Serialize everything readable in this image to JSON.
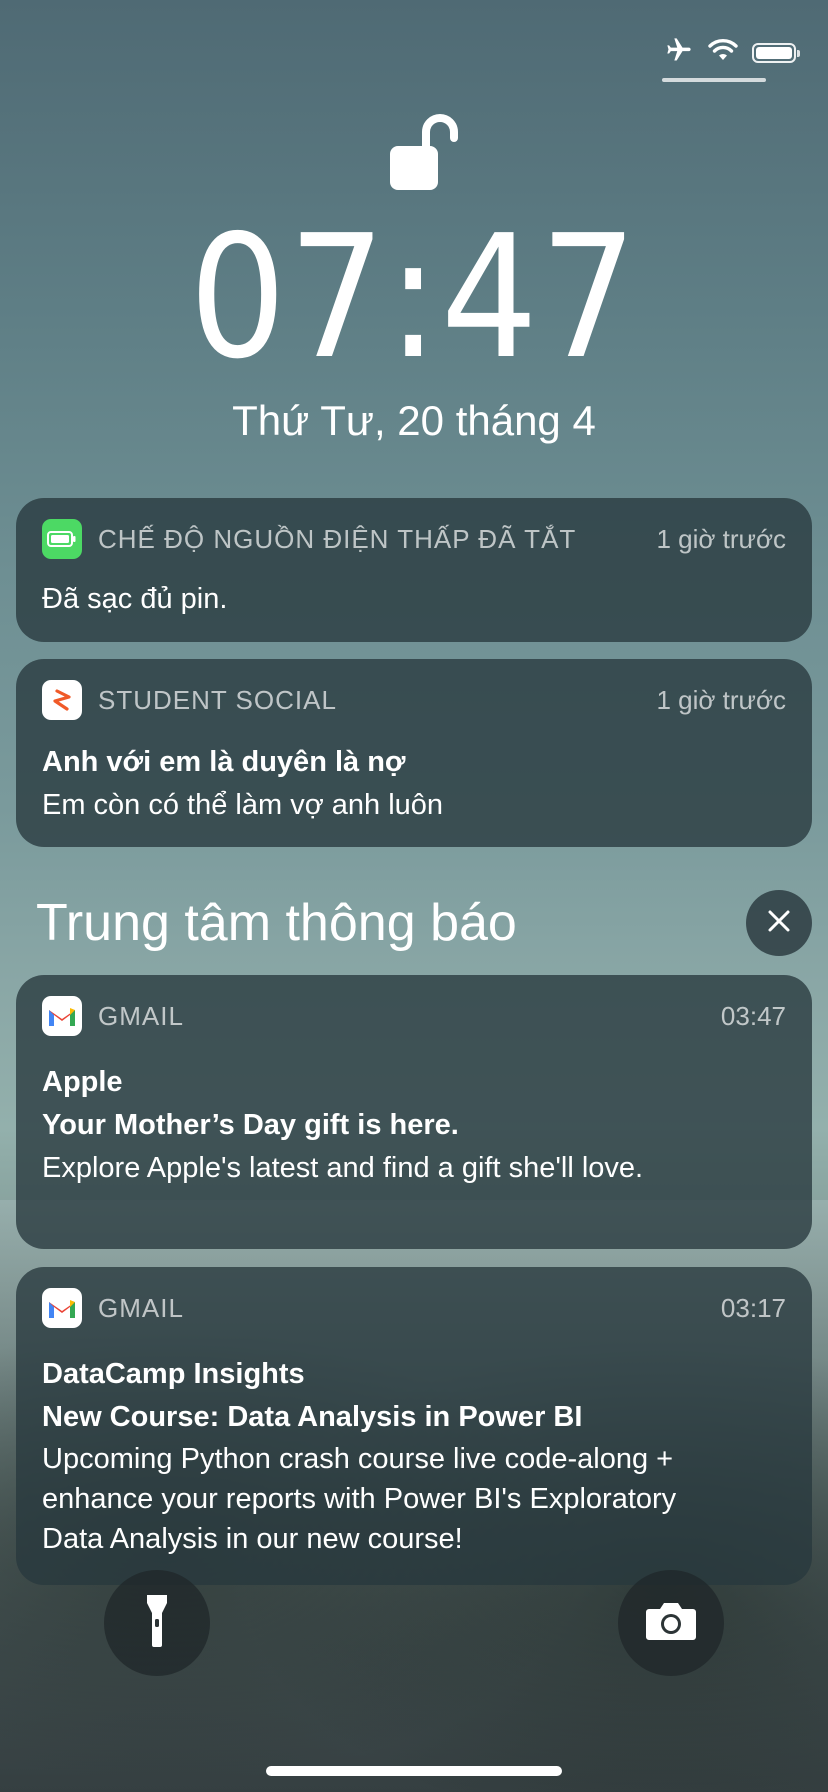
{
  "status_bar": {
    "icons": [
      "airplane-icon",
      "wifi-icon",
      "battery-icon"
    ]
  },
  "lock_screen": {
    "time": "07:47",
    "date": "Thứ Tư, 20 tháng 4"
  },
  "notifications": [
    {
      "app": "CHẾ ĐỘ NGUỒN ĐIỆN THẤP ĐÃ TẮT",
      "time": "1 giờ trước",
      "icon": "battery-app-icon",
      "body": "Đã sạc đủ pin."
    },
    {
      "app": "STUDENT SOCIAL",
      "time": "1 giờ trước",
      "icon": "student-social-icon",
      "title": "Anh với em là duyên là nợ",
      "body": "Em còn có thể làm vợ anh luôn"
    }
  ],
  "notification_center": {
    "title": "Trung tâm thông báo",
    "items": [
      {
        "app": "GMAIL",
        "time": "03:47",
        "icon": "gmail-icon",
        "sender": "Apple",
        "subject": "Your Mother’s Day gift is here.",
        "preview": "Explore Apple's latest and find a gift she'll love."
      },
      {
        "app": "GMAIL",
        "time": "03:17",
        "icon": "gmail-icon",
        "sender": "DataCamp Insights",
        "subject": "New Course: Data Analysis in Power BI",
        "preview_lines": [
          "Upcoming Python crash course live code-along +",
          "enhance your reports with Power BI's Exploratory",
          "Data Analysis in our new course!"
        ]
      }
    ]
  },
  "bottom_controls": [
    "flashlight-icon",
    "camera-icon"
  ],
  "colors": {
    "card_bg": "#28383e",
    "battery_green": "#4cd964",
    "gmail_red": "#ea4335",
    "student_social_orange": "#f05a28"
  }
}
